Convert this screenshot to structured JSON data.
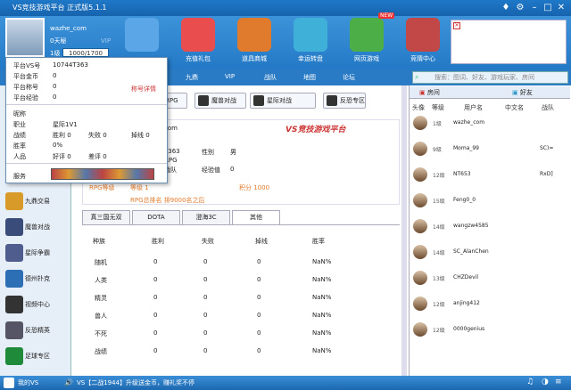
{
  "titlebar": {
    "title": "VS竞技游戏平台 正式版5.1.1"
  },
  "user": {
    "name": "wazhe_com",
    "gold": "0天秘",
    "vip": "VIP",
    "level": "1级",
    "exp": "1000/1700"
  },
  "toolbar": [
    {
      "label": "",
      "color": "#5aa6e6"
    },
    {
      "label": "充值礼包",
      "color": "#e94d4d"
    },
    {
      "label": "道具商城",
      "color": "#e07a2c"
    },
    {
      "label": "幸运转盘",
      "color": "#3fb0d8"
    },
    {
      "label": "网页游戏",
      "color": "#4cae46"
    },
    {
      "label": "竞猜中心",
      "color": "#c24747"
    }
  ],
  "tool_badge": "NEW",
  "nav": [
    "九鼎",
    "VIP",
    "战队",
    "地图",
    "论坛"
  ],
  "search_placeholder": "搜索：图词、好友、游戏玩家、房间",
  "popup": {
    "rows": [
      {
        "k": "平台VS号",
        "v": "10744T363"
      },
      {
        "k": "平台金币",
        "v": "0"
      },
      {
        "k": "平台称号",
        "v": "0"
      },
      {
        "k": "平台经验",
        "v": "0"
      }
    ],
    "title_link": "称号详情",
    "nick": "昵称",
    "job_label": "职业",
    "job": "星际1V1",
    "stats_label": "战绩",
    "win": "胜利 0",
    "lose": "失败 0",
    "flee": "掉线 0",
    "winrate_label": "胜率",
    "winrate": "0%",
    "rep_label": "人品",
    "good": "好评 0",
    "bad": "差评 0",
    "service_label": "服务"
  },
  "game_tabs": [
    "RPG",
    "魔兽对战",
    "星际对战",
    "反恐专区"
  ],
  "profile": {
    "idpart": "com",
    "vs": "T363",
    "rpg": "RPG",
    "team": "战队",
    "gender_label": "性别",
    "gender": "男",
    "exp_label": "经验值",
    "exp": "0",
    "rpg_level": "RPG等级",
    "lvl": "等级 1",
    "points": "积分 1000",
    "rank": "RPG总排名 排9000名之后",
    "brand": "VS竞技游戏平台"
  },
  "sub_tabs": [
    "真三国无双",
    "DOTA",
    "澄海3C",
    "其他"
  ],
  "table": {
    "headers": [
      "种族",
      "胜利",
      "失败",
      "掉线",
      "胜率"
    ],
    "rows": [
      [
        "随机",
        "0",
        "0",
        "0",
        "NaN%"
      ],
      [
        "人类",
        "0",
        "0",
        "0",
        "NaN%"
      ],
      [
        "精灵",
        "0",
        "0",
        "0",
        "NaN%"
      ],
      [
        "兽人",
        "0",
        "0",
        "0",
        "NaN%"
      ],
      [
        "不死",
        "0",
        "0",
        "0",
        "NaN%"
      ],
      [
        "战绩",
        "0",
        "0",
        "0",
        "NaN%"
      ]
    ]
  },
  "left_menu": [
    {
      "label": "九鼎交易",
      "color": "#d89b2a"
    },
    {
      "label": "魔兽对战",
      "color": "#3a4c7a"
    },
    {
      "label": "星际争霸",
      "color": "#4f5c8e"
    },
    {
      "label": "德州扑克",
      "color": "#2c6fb4"
    },
    {
      "label": "视频中心",
      "color": "#333"
    },
    {
      "label": "反恐精英",
      "color": "#556"
    },
    {
      "label": "足球专区",
      "color": "#1e8a3a"
    }
  ],
  "right": {
    "tabs": [
      "房间",
      "好友"
    ],
    "headers": [
      "头像",
      "等级",
      "用户名",
      "中文名",
      "战队"
    ],
    "users": [
      {
        "lvl": "1级",
        "name": "wazhe_com",
        "team": ""
      },
      {
        "lvl": "9级",
        "name": "Moma_99",
        "team": "SC)="
      },
      {
        "lvl": "12级",
        "name": "NT653",
        "team": "RxD]"
      },
      {
        "lvl": "15级",
        "name": "Feng0_0",
        "team": ""
      },
      {
        "lvl": "14级",
        "name": "wangzw4585",
        "team": ""
      },
      {
        "lvl": "14级",
        "name": "SC_AlanChen",
        "team": ""
      },
      {
        "lvl": "13级",
        "name": "CHZDevil",
        "team": ""
      },
      {
        "lvl": "12级",
        "name": "anjing412",
        "team": ""
      },
      {
        "lvl": "12级",
        "name": "0000genius",
        "team": ""
      }
    ]
  },
  "status": {
    "brand": "我的VS",
    "ticker": "VS【二战1944】升级送金币，赚礼奖不停"
  }
}
